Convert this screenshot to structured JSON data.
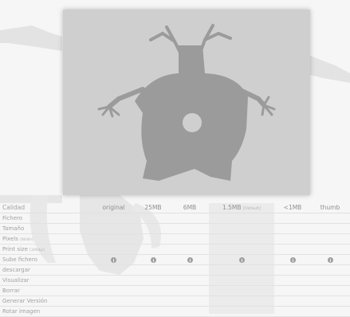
{
  "columns": [
    {
      "label": "original",
      "sub": ""
    },
    {
      "label": "25MB",
      "sub": ""
    },
    {
      "label": "6MB",
      "sub": ""
    },
    {
      "label": "1.5MB",
      "sub": "[Default]"
    },
    {
      "label": "<1MB",
      "sub": ""
    },
    {
      "label": "thumb",
      "sub": ""
    }
  ],
  "rows": {
    "header": {
      "label": "Calidad",
      "sub": ""
    },
    "r1": {
      "label": "Fichero",
      "sub": ""
    },
    "r2": {
      "label": "Tamaño",
      "sub": ""
    },
    "r3": {
      "label": "Pixels",
      "sub": "[Width]"
    },
    "r4": {
      "label": "Print size",
      "sub": "[300dpi]"
    },
    "r5": {
      "label": "Sube fichero",
      "sub": ""
    },
    "r6": {
      "label": "descargar",
      "sub": ""
    },
    "r7": {
      "label": "Visualizar",
      "sub": ""
    },
    "r8": {
      "label": "Borrar",
      "sub": ""
    },
    "r9": {
      "label": "Generar Versión",
      "sub": ""
    },
    "r10": {
      "label": "Rotar imagen",
      "sub": ""
    }
  },
  "icons": {
    "upload": "upload-icon"
  },
  "colors": {
    "figure": "#9b9b9b",
    "card": "#cfcfcf",
    "background_figure": "#e1e1e1"
  }
}
